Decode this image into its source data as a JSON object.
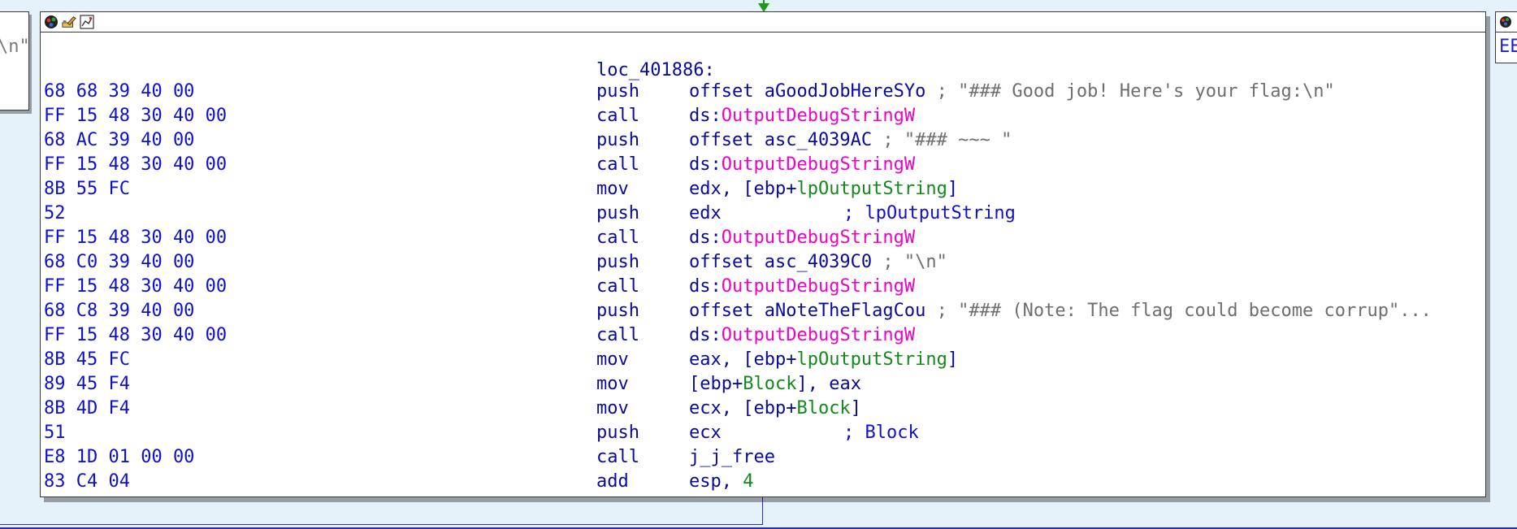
{
  "colors": {
    "background": "#e6f2fa",
    "node_bg": "#ffffff",
    "bytes": "#0f0fd2",
    "mnemonic": "#0a0a9e",
    "function_ref": "#f000c8",
    "variable_ref": "#12891d",
    "comment_string": "#6e6e6e",
    "edge_green": "#1a9e1a",
    "edge_blue": "#2a2ad0"
  },
  "left_node": {
    "fragment": "\\n\""
  },
  "right_node": {
    "fragment": "EE"
  },
  "node": {
    "title_icons": [
      "color-palette-icon",
      "rename-icon",
      "graph-overview-icon"
    ],
    "label": "loc_401886:",
    "rows": [
      {
        "bytes": "68 68 39 40 00",
        "mnemonic": "push",
        "op1": "offset aGoodJobHereSYo",
        "comment": "; \"### Good job! Here's your flag:\\n\""
      },
      {
        "bytes": "FF 15 48 30 40 00",
        "mnemonic": "call",
        "prefix": "ds:",
        "func": "OutputDebugStringW"
      },
      {
        "bytes": "68 AC 39 40 00",
        "mnemonic": "push",
        "op1": "offset asc_4039AC",
        "comment": "; \"### ~~~ \""
      },
      {
        "bytes": "FF 15 48 30 40 00",
        "mnemonic": "call",
        "prefix": "ds:",
        "func": "OutputDebugStringW"
      },
      {
        "bytes": "8B 55 FC",
        "mnemonic": "mov",
        "op_pre": "edx, [ebp+",
        "var": "lpOutputString",
        "op_post": "]"
      },
      {
        "bytes": "52",
        "mnemonic": "push",
        "op1": "edx",
        "comment_sym": "; lpOutputString"
      },
      {
        "bytes": "FF 15 48 30 40 00",
        "mnemonic": "call",
        "prefix": "ds:",
        "func": "OutputDebugStringW"
      },
      {
        "bytes": "68 C0 39 40 00",
        "mnemonic": "push",
        "op1": "offset asc_4039C0",
        "comment": "; \"\\n\""
      },
      {
        "bytes": "FF 15 48 30 40 00",
        "mnemonic": "call",
        "prefix": "ds:",
        "func": "OutputDebugStringW"
      },
      {
        "bytes": "68 C8 39 40 00",
        "mnemonic": "push",
        "op1": "offset aNoteTheFlagCou",
        "comment": "; \"### (Note: The flag could become corrup\"..."
      },
      {
        "bytes": "FF 15 48 30 40 00",
        "mnemonic": "call",
        "prefix": "ds:",
        "func": "OutputDebugStringW"
      },
      {
        "bytes": "8B 45 FC",
        "mnemonic": "mov",
        "op_pre": "eax, [ebp+",
        "var": "lpOutputString",
        "op_post": "]"
      },
      {
        "bytes": "89 45 F4",
        "mnemonic": "mov",
        "op_pre": "[ebp+",
        "var": "Block",
        "op_post": "], eax"
      },
      {
        "bytes": "8B 4D F4",
        "mnemonic": "mov",
        "op_pre": "ecx, [ebp+",
        "var": "Block",
        "op_post": "]"
      },
      {
        "bytes": "51",
        "mnemonic": "push",
        "op1": "ecx",
        "comment_sym": "; Block"
      },
      {
        "bytes": "E8 1D 01 00 00",
        "mnemonic": "call",
        "op1": "j_j_free"
      },
      {
        "bytes": "83 C4 04",
        "mnemonic": "add",
        "op_pre": "esp, ",
        "num": "4",
        "op_post": ""
      }
    ]
  }
}
